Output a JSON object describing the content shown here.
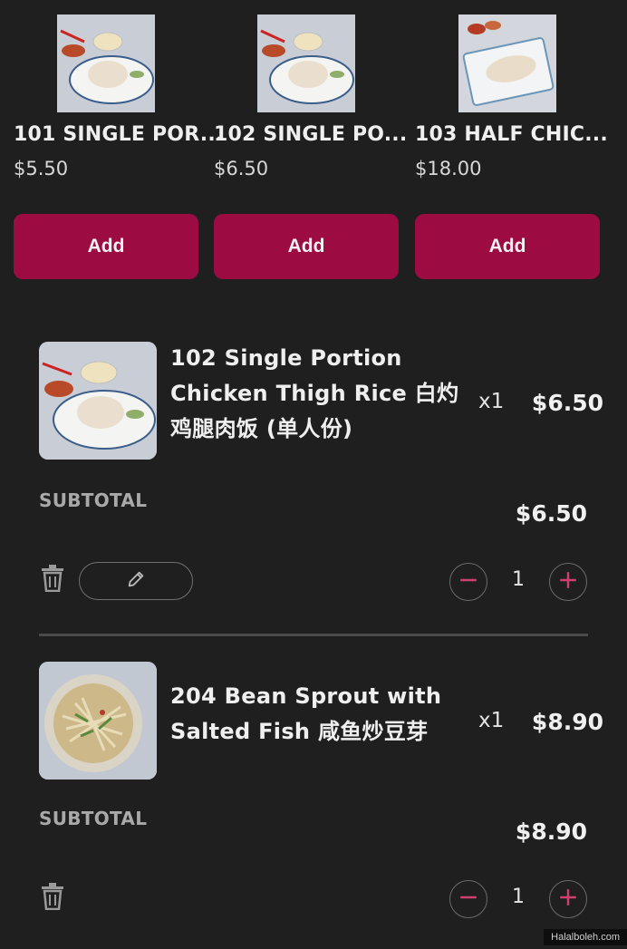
{
  "recommendations": [
    {
      "name": "101 SINGLE POR...",
      "price": "$5.50",
      "add_label": "Add",
      "image": "chicken-rice-plate"
    },
    {
      "name": "102 SINGLE PO...",
      "price": "$6.50",
      "add_label": "Add",
      "image": "chicken-rice-plate"
    },
    {
      "name": "103 HALF CHIC...",
      "price": "$18.00",
      "add_label": "Add",
      "image": "sliced-chicken-platter"
    }
  ],
  "cart": [
    {
      "image": "chicken-rice-plate",
      "name": "102 Single Portion Chicken Thigh Rice 白灼鸡腿肉饭 (单人份)",
      "qty_label": "x1",
      "price": "$6.50",
      "subtotal_label": "SUBTOTAL",
      "subtotal": "$6.50",
      "quantity": "1"
    },
    {
      "image": "bean-sprout-plate",
      "name": "204 Bean Sprout with Salted Fish 咸鱼炒豆芽",
      "qty_label": "x1",
      "price": "$8.90",
      "subtotal_label": "SUBTOTAL",
      "subtotal": "$8.90",
      "quantity": "1"
    }
  ],
  "icons": {
    "delete": "trash-icon",
    "edit": "pencil-icon",
    "decrease": "minus-icon",
    "increase": "plus-icon"
  },
  "colors": {
    "background": "#1f1f1f",
    "accent": "#9c0c42",
    "stepper_icon": "#d0406f"
  },
  "watermark": "Halalboleh.com"
}
